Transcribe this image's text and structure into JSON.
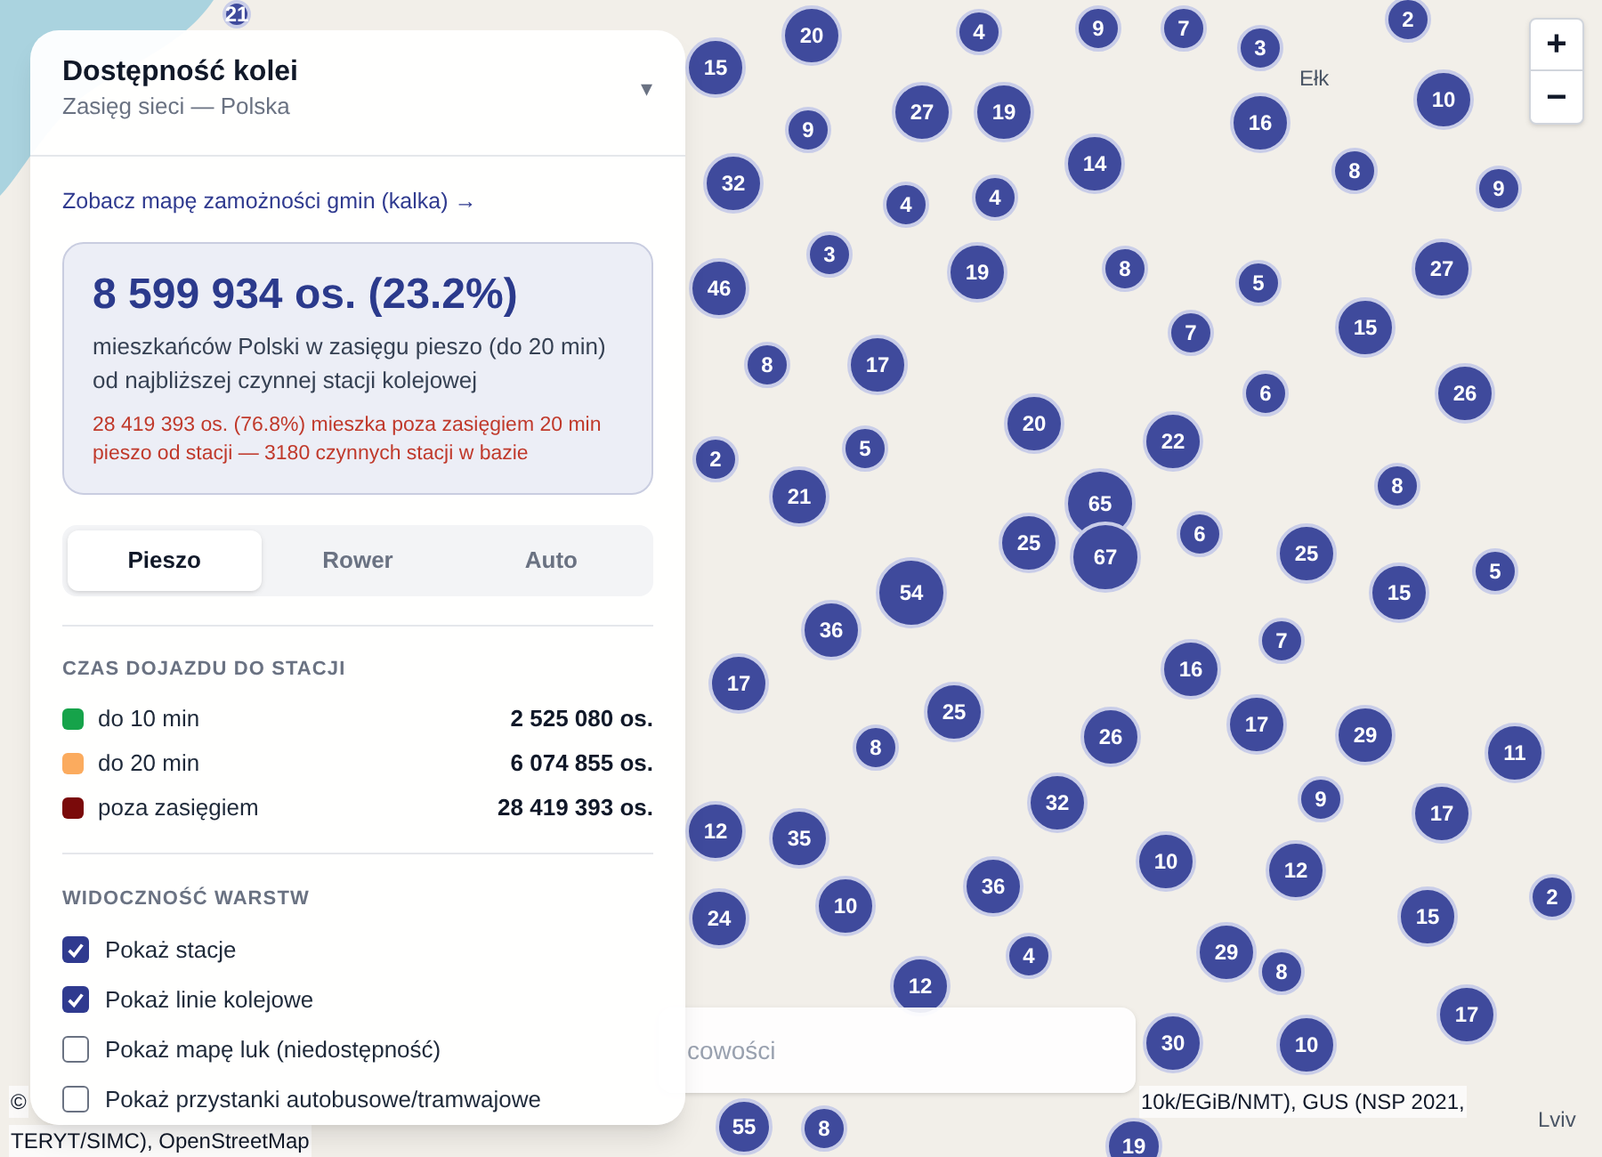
{
  "panel": {
    "title": "Dostępność kolei",
    "subtitle": "Zasięg sieci — Polska",
    "toggle": "▾",
    "link": "Zobacz mapę zamożności gmin (kalka) →",
    "summary": {
      "headline": "8 599 934 os. (23.2%)",
      "description": "mieszkańców Polski w zasięgu pieszo (do 20 min) od najbliższej czynnej stacji kolejowej",
      "warning": "28 419 393 os. (76.8%) mieszka poza zasięgiem 20 min pieszo od stacji — 3180 czynnych stacji w bazie"
    },
    "modes": [
      {
        "label": "Pieszo",
        "selected": true
      },
      {
        "label": "Rower",
        "selected": false
      },
      {
        "label": "Auto",
        "selected": false
      }
    ],
    "legend_title": "CZAS DOJAZDU DO STACJI",
    "legend": [
      {
        "label": "do 10 min",
        "value": "2 525 080 os.",
        "color": "#16a34a"
      },
      {
        "label": "do 20 min",
        "value": "6 074 855 os.",
        "color": "#fbab5e"
      },
      {
        "label": "poza zasięgiem",
        "value": "28 419 393 os.",
        "color": "#7a0a0a"
      }
    ],
    "layers_title": "WIDOCZNOŚĆ WARSTW",
    "layers": [
      {
        "label": "Pokaż stacje",
        "checked": true
      },
      {
        "label": "Pokaż linie kolejowe",
        "checked": true
      },
      {
        "label": "Pokaż mapę luk (niedostępność)",
        "checked": false
      },
      {
        "label": "Pokaż przystanki autobusowe/tramwajowe",
        "checked": false
      }
    ]
  },
  "map": {
    "labels": [
      "Ełk",
      "Lviv"
    ],
    "clusters": [
      "21",
      "15",
      "20",
      "4",
      "9",
      "7",
      "3",
      "2",
      "9",
      "27",
      "19",
      "16",
      "10",
      "32",
      "4",
      "4",
      "14",
      "8",
      "9",
      "3",
      "19",
      "8",
      "5",
      "27",
      "46",
      "7",
      "15",
      "8",
      "17",
      "6",
      "26",
      "5",
      "20",
      "22",
      "2",
      "21",
      "65",
      "67",
      "6",
      "8",
      "25",
      "25",
      "5",
      "54",
      "15",
      "36",
      "7",
      "17",
      "16",
      "25",
      "17",
      "29",
      "11",
      "8",
      "26",
      "32",
      "9",
      "17",
      "12",
      "35",
      "10",
      "36",
      "12",
      "2",
      "24",
      "10",
      "4",
      "15",
      "29",
      "8",
      "12",
      "17",
      "30",
      "10",
      "55",
      "8",
      "19"
    ],
    "search": {
      "placeholder": "cowości"
    },
    "zoom_in": "+",
    "zoom_out": "−",
    "attribution": [
      "©",
      "10k/EGiB/NMT), GUS (NSP 2021,",
      "TERYT/SIMC), OpenStreetMap"
    ]
  }
}
